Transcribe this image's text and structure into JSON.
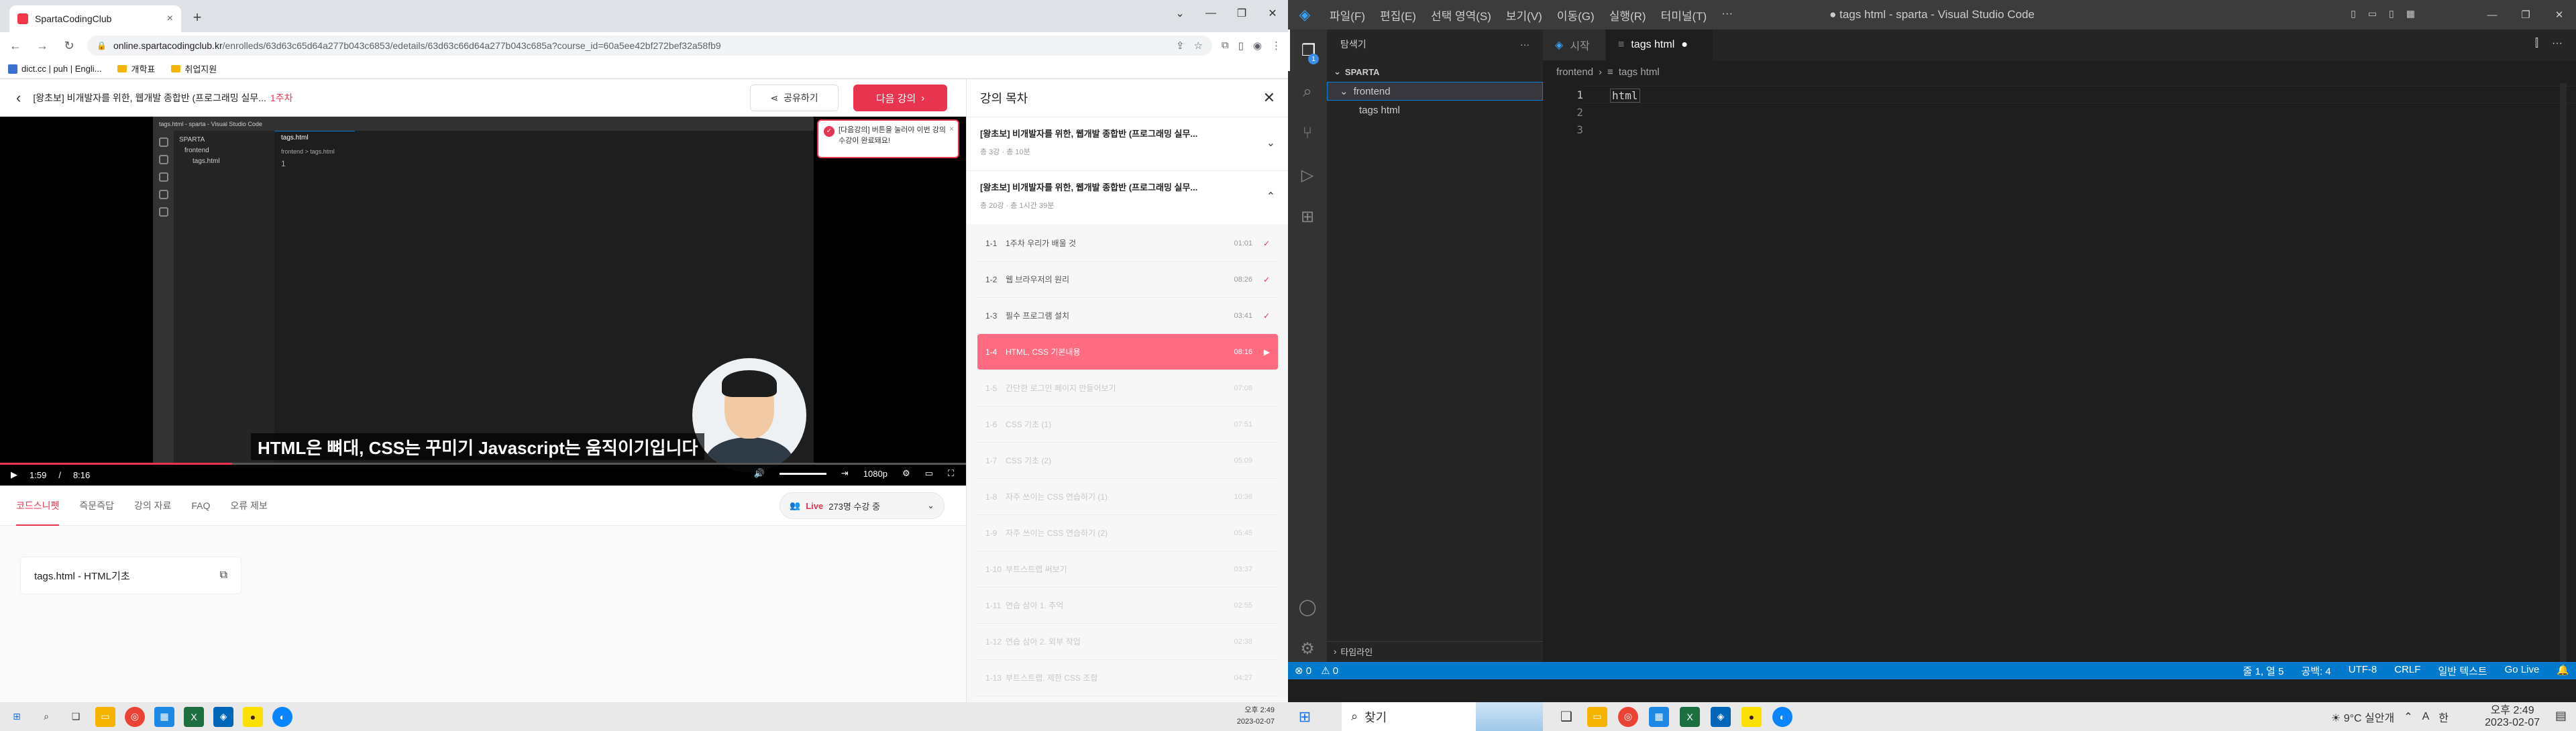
{
  "chrome": {
    "tab_title": "SpartaCodingClub",
    "url_domain": "online.spartacodingclub.kr",
    "url_path": "/enrolleds/63d63c65d64a277b043c6853/edetails/63d63c66d64a277b043c685a?course_id=60a5ee42bf272bef32a58fb9",
    "bookmarks": [
      "dict.cc | puh | Engli...",
      "개학표",
      "취업지원"
    ]
  },
  "lecture": {
    "title": "[왕초보] 비개발자를 위한, 웹개발 종합반 (프로그래밍 실무...",
    "week": "1주차",
    "share_label": "공유하기",
    "next_label": "다음 강의",
    "subtitle": "HTML은 뼈대, CSS는 꾸미기 Javascript는 움직이기입니다",
    "toast": "[다음강의] 버튼을 눌러야 이번 강의 수강이 완료돼요!",
    "time_current": "1:59",
    "time_sep": "/",
    "time_total": "8:16",
    "quality": "1080p",
    "progress": 0.24,
    "tabs": [
      "코드스니펫",
      "즉문즉답",
      "강의 자료",
      "FAQ",
      "오류 제보"
    ],
    "live_label": "Live",
    "live_count": "273명 수강 중",
    "snippet": "tags.html - HTML기초",
    "video_vscode": {
      "title": "tags.html - sparta - Visual Studio Code",
      "tab": "tags.html",
      "crumb": "frontend > tags.html",
      "sparta": "SPARTA",
      "folder": "frontend",
      "file": "tags.html",
      "line": "1"
    }
  },
  "syllabus": {
    "title": "강의 목차",
    "courses": [
      {
        "title": "[왕초보] 비개발자를 위한, 웹개발 종합반 (프로그래밍 실무...",
        "meta": "총 3강 · 총 10분"
      },
      {
        "title": "[왕초보] 비개발자를 위한, 웹개발 종합반 (프로그래밍 실무...",
        "meta": "총 20강 · 총 1시간 39분"
      }
    ],
    "lessons": [
      {
        "num": "1-1",
        "name": "1주차 우리가 배울 것",
        "time": "01:01",
        "state": "done"
      },
      {
        "num": "1-2",
        "name": "웹 브라우저의 원리",
        "time": "08:26",
        "state": "done"
      },
      {
        "num": "1-3",
        "name": "필수 프로그램 설치",
        "time": "03:41",
        "state": "done"
      },
      {
        "num": "1-4",
        "name": "HTML, CSS 기본내용",
        "time": "08:16",
        "state": "active"
      },
      {
        "num": "1-5",
        "name": "간단한 로그인 페이지 만들어보기",
        "time": "07:08",
        "state": "locked"
      },
      {
        "num": "1-6",
        "name": "CSS 기초 (1)",
        "time": "07:51",
        "state": "locked"
      },
      {
        "num": "1-7",
        "name": "CSS 기초 (2)",
        "time": "05:09",
        "state": "locked"
      },
      {
        "num": "1-8",
        "name": "자주 쓰이는 CSS 연습하기 (1)",
        "time": "10:36",
        "state": "locked"
      },
      {
        "num": "1-9",
        "name": "자주 쓰이는 CSS 연습하기 (2)",
        "time": "05:45",
        "state": "locked"
      },
      {
        "num": "1-10",
        "name": "부트스트랩 써보기",
        "time": "03:37",
        "state": "locked"
      },
      {
        "num": "1-11",
        "name": "연습 삼아 1. 추억",
        "time": "02:55",
        "state": "locked"
      },
      {
        "num": "1-12",
        "name": "연습 삼아 2. 외부 작업",
        "time": "02:38",
        "state": "locked"
      },
      {
        "num": "1-13",
        "name": "부트스트랩, 제한 CSS 조합",
        "time": "04:27",
        "state": "locked"
      }
    ]
  },
  "vscode": {
    "menu": [
      "파일(F)",
      "편집(E)",
      "선택 영역(S)",
      "보기(V)",
      "이동(G)",
      "실행(R)",
      "터미널(T)",
      "···"
    ],
    "window_title": "● tags html - sparta - Visual Studio Code",
    "explorer_title": "탐색기",
    "workspace": "SPARTA",
    "folder": "frontend",
    "file": "tags html",
    "timeline": "타임라인",
    "tabs": [
      {
        "label": "시작"
      },
      {
        "label": "tags html",
        "dirty": "●"
      }
    ],
    "breadcrumb": [
      "frontend",
      "tags html"
    ],
    "lines": [
      "1",
      "2",
      "3"
    ],
    "code": "html",
    "badge": "1",
    "status_left": [
      "⊗ 0",
      "⚠ 0"
    ],
    "status_right": [
      "줄 1, 열 5",
      "공백: 4",
      "UTF-8",
      "CRLF",
      "일반 텍스트",
      "Go Live"
    ]
  },
  "taskbar_left": {
    "time": "오후 2:49",
    "date": "2023-02-07"
  },
  "taskbar_right": {
    "search": "찾기",
    "weather": "9°C  실안개",
    "time": "오후 2:49",
    "date": "2023-02-07",
    "ime": "A",
    "lang": "한"
  },
  "colors": {
    "accent": "#e8344e",
    "vs_blue": "#007acc"
  }
}
